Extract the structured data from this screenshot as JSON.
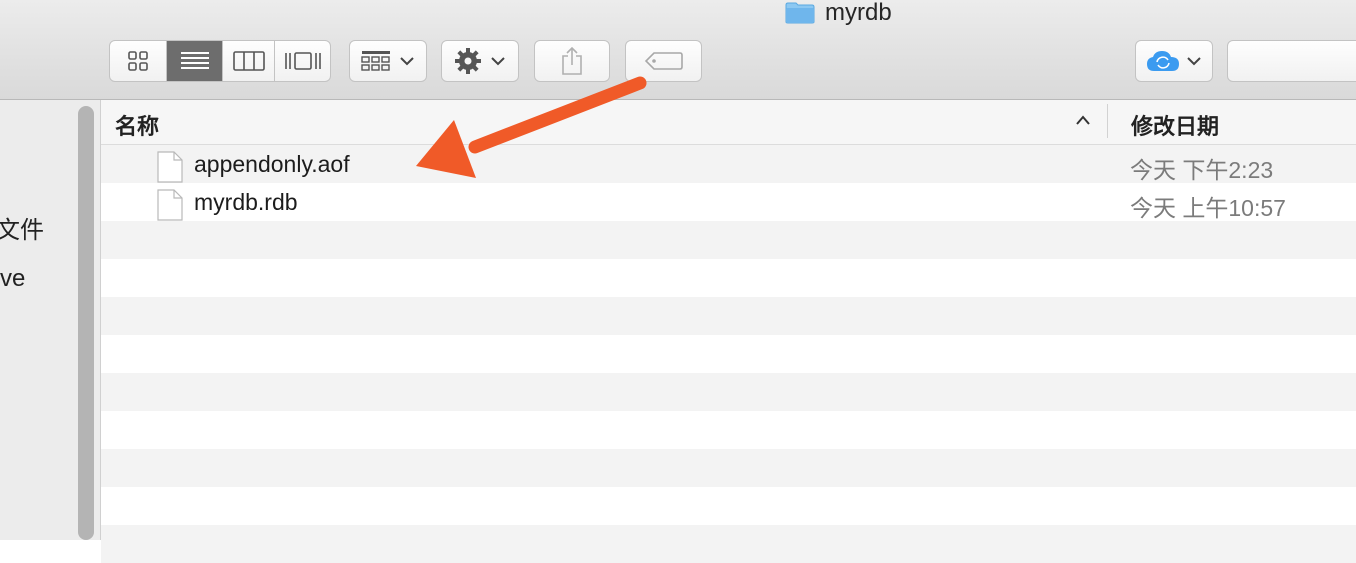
{
  "window": {
    "title": "myrdb"
  },
  "toolbar": {
    "view_modes": [
      "icon-view",
      "list-view",
      "column-view",
      "cover-flow-view"
    ],
    "active_view": "list-view",
    "buttons": [
      "arrange-button",
      "action-button",
      "share-button",
      "tag-button",
      "icloud-button"
    ]
  },
  "sidebar": {
    "partial_items": [
      "文件",
      "ve"
    ]
  },
  "columns": {
    "name": "名称",
    "date_modified": "修改日期"
  },
  "files": [
    {
      "name": "appendonly.aof",
      "date": "今天 下午2:23"
    },
    {
      "name": "myrdb.rdb",
      "date": "今天 上午10:57"
    }
  ],
  "annotation": {
    "type": "arrow",
    "color": "#f05a28",
    "points_to": "appendonly.aof"
  },
  "colors": {
    "accent": "#f05a28",
    "folder": "#6fb6ec",
    "icloud": "#3b9bf0"
  }
}
